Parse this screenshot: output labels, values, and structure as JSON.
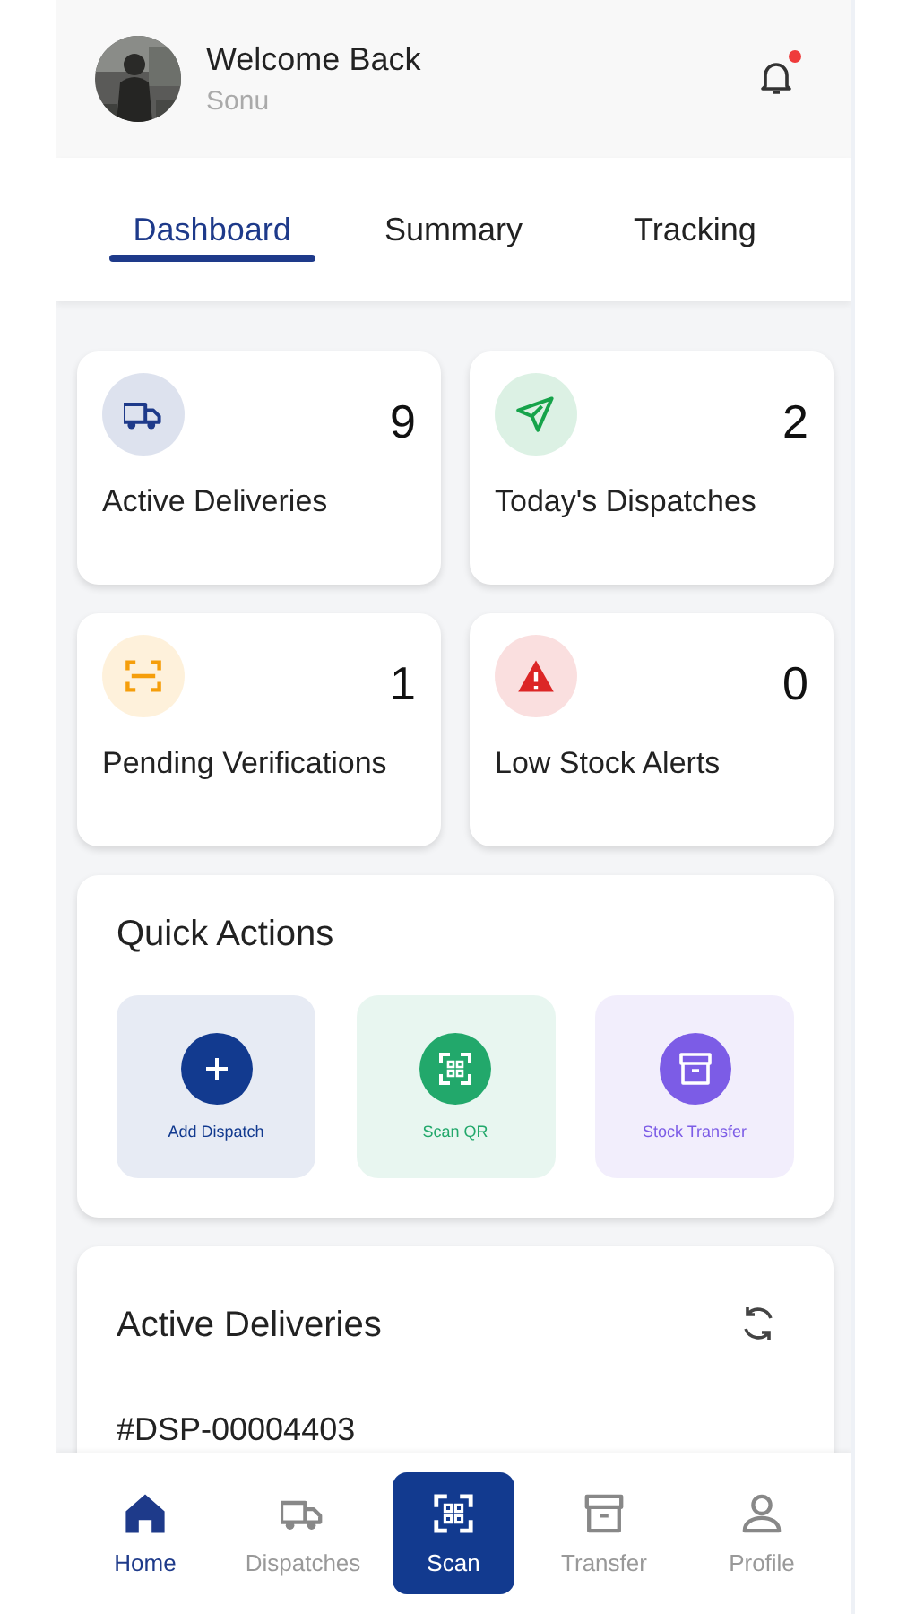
{
  "header": {
    "greeting": "Welcome Back",
    "user": "Sonu",
    "notification_unread": true
  },
  "tabs": [
    {
      "label": "Dashboard",
      "selected": true
    },
    {
      "label": "Summary",
      "selected": false
    },
    {
      "label": "Tracking",
      "selected": false
    }
  ],
  "stats": [
    {
      "kind": "truck",
      "color": "#1e3a8a",
      "value": "9",
      "label": "Active Deliveries"
    },
    {
      "kind": "send",
      "color": "#16a34a",
      "value": "2",
      "label": "Today's Dispatches"
    },
    {
      "kind": "scan",
      "color": "#f59e0b",
      "value": "1",
      "label": "Pending Verifications"
    },
    {
      "kind": "alert",
      "color": "#dc2626",
      "value": "0",
      "label": "Low Stock Alerts"
    }
  ],
  "quick_actions": {
    "title": "Quick Actions",
    "items": [
      {
        "kind": "plus",
        "color": "#123a8f",
        "label": "Add Dispatch"
      },
      {
        "kind": "qr",
        "color": "#22a86b",
        "label": "Scan QR"
      },
      {
        "kind": "archive",
        "color": "#7c5ce6",
        "label": "Stock Transfer"
      }
    ]
  },
  "active_deliveries": {
    "title": "Active Deliveries",
    "first_id": "#DSP-00004403"
  },
  "nav": [
    {
      "kind": "home",
      "label": "Home",
      "selected": true,
      "raised": false
    },
    {
      "kind": "truck",
      "label": "Dispatches",
      "selected": false,
      "raised": false
    },
    {
      "kind": "qr",
      "label": "Scan",
      "selected": false,
      "raised": true
    },
    {
      "kind": "archive",
      "label": "Transfer",
      "selected": false,
      "raised": false
    },
    {
      "kind": "user",
      "label": "Profile",
      "selected": false,
      "raised": false
    }
  ]
}
